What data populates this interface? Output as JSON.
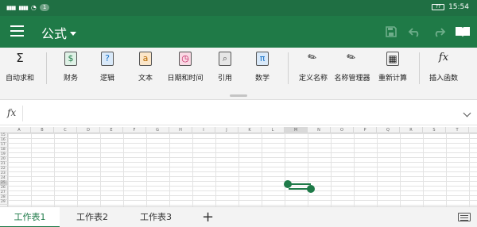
{
  "status": {
    "signal_1": "▮▮▮▮",
    "signal_2": "▮▮▮▮",
    "wifi": "◔",
    "badge": "1",
    "battery": "77",
    "time": "15:54"
  },
  "appbar": {
    "title": "公式"
  },
  "ribbon": {
    "items": [
      {
        "label": "自动求和",
        "icon": "Σ",
        "icon_name": "sigma-icon",
        "color": "#222222"
      },
      {
        "label": "财务",
        "icon": "$",
        "icon_name": "finance-icon",
        "color": "#1f7a47"
      },
      {
        "label": "逻辑",
        "icon": "?",
        "icon_name": "logic-icon",
        "color": "#1a73c7"
      },
      {
        "label": "文本",
        "icon": "a",
        "icon_name": "text-icon",
        "color": "#b86a00"
      },
      {
        "label": "日期和时间",
        "icon": "◷",
        "icon_name": "clock-icon",
        "color": "#c2185b"
      },
      {
        "label": "引用",
        "icon": "⌕",
        "icon_name": "lookup-icon",
        "color": "#555555"
      },
      {
        "label": "数学",
        "icon": "π",
        "icon_name": "math-icon",
        "color": "#1a73c7"
      },
      {
        "label": "定义名称",
        "icon": "✎",
        "icon_name": "define-name-icon",
        "color": "#444444"
      },
      {
        "label": "名称管理器",
        "icon": "✎",
        "icon_name": "name-manager-icon",
        "color": "#444444"
      },
      {
        "label": "重新计算",
        "icon": "▦",
        "icon_name": "recalculate-icon",
        "color": "#444444"
      },
      {
        "label": "插入函数",
        "icon": "fx",
        "icon_name": "insert-function-icon",
        "color": "#222222"
      }
    ]
  },
  "formula": {
    "fx": "fx"
  },
  "grid": {
    "columns": [
      "A",
      "B",
      "C",
      "D",
      "E",
      "F",
      "G",
      "H",
      "I",
      "J",
      "K",
      "L",
      "M",
      "N",
      "O",
      "P",
      "Q",
      "R",
      "S",
      "T"
    ],
    "selected_column": "M",
    "rows": [
      "15",
      "16",
      "17",
      "18",
      "19",
      "20",
      "21",
      "22",
      "23",
      "24",
      "25",
      "26",
      "27",
      "28",
      "29"
    ],
    "selected_row": "25"
  },
  "tabs": {
    "sheets": [
      "工作表1",
      "工作表2",
      "工作表3"
    ],
    "add": "+"
  }
}
